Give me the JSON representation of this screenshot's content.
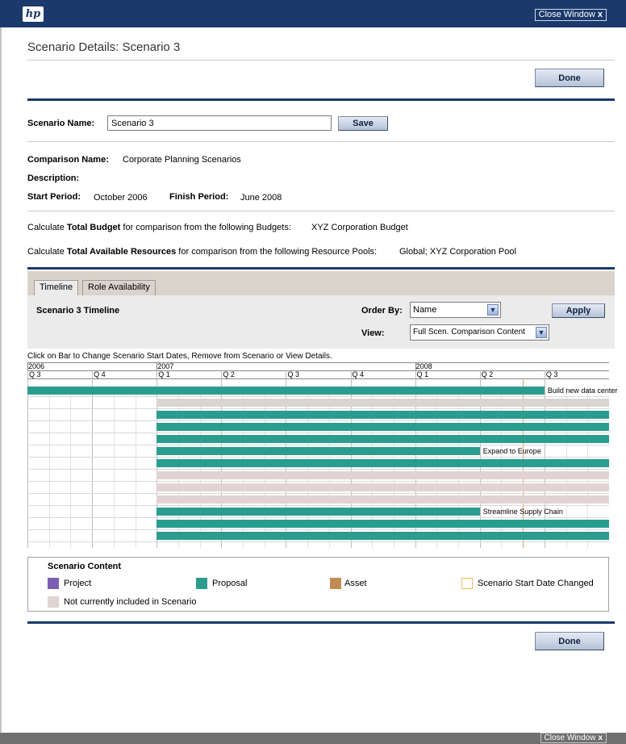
{
  "window": {
    "logo_text": "hp",
    "close_label": "Close Window",
    "close_x": "x"
  },
  "page": {
    "title": "Scenario Details: Scenario 3",
    "done_label": "Done"
  },
  "scenario": {
    "name_label": "Scenario Name:",
    "name_value": "Scenario 3",
    "save_label": "Save",
    "comparison_label": "Comparison Name:",
    "comparison_value": "Corporate Planning Scenarios",
    "description_label": "Description:",
    "start_label": "Start Period:",
    "start_value": "October 2006",
    "finish_label": "Finish Period:",
    "finish_value": "June 2008",
    "budget_pre": "Calculate",
    "budget_bold": "Total Budget",
    "budget_post": "for comparison from the following Budgets:",
    "budget_value": "XYZ Corporation Budget",
    "resources_pre": "Calculate",
    "resources_bold": "Total Available Resources",
    "resources_post": "for comparison from the following Resource Pools:",
    "resources_value": "Global; XYZ Corporation Pool"
  },
  "tabs": [
    {
      "label": "Timeline",
      "active": true
    },
    {
      "label": "Role Availability",
      "active": false
    }
  ],
  "timeline_panel": {
    "heading": "Scenario 3 Timeline",
    "order_by_label": "Order By:",
    "order_by_value": "Name",
    "view_label": "View:",
    "view_value": "Full Scen. Comparison Content",
    "apply_label": "Apply",
    "instructions": "Click on Bar to Change Scenario Start Dates, Remove from Scenario or View Details."
  },
  "timeline": {
    "years": [
      "2006",
      "2007",
      "2008"
    ],
    "quarters": [
      "Q 3",
      "Q 4",
      "Q 1",
      "Q 2",
      "Q 3",
      "Q 4",
      "Q 1",
      "Q 2",
      "Q 3"
    ],
    "rows": [
      {
        "start": "Q3 2006",
        "end": "Q2 2008",
        "type": "proposal",
        "label": "Build new data center"
      },
      {
        "start": "Q1 2007",
        "end": "Q3 2008",
        "type": "excluded",
        "label": ""
      },
      {
        "start": "Q1 2007",
        "end": "Q3 2008",
        "type": "proposal",
        "label": ""
      },
      {
        "start": "Q1 2007",
        "end": "Q3 2008",
        "type": "proposal",
        "label": ""
      },
      {
        "start": "Q1 2007",
        "end": "Q3 2008",
        "type": "proposal",
        "label": ""
      },
      {
        "start": "Q1 2007",
        "end": "Q1 2008",
        "type": "proposal",
        "label": "Expand to Europe"
      },
      {
        "start": "Q1 2007",
        "end": "Q3 2008",
        "type": "proposal",
        "label": ""
      },
      {
        "start": "Q1 2007",
        "end": "Q3 2008",
        "type": "excluded_pink",
        "label": ""
      },
      {
        "start": "Q1 2007",
        "end": "Q3 2008",
        "type": "excluded_pink",
        "label": ""
      },
      {
        "start": "Q1 2007",
        "end": "Q3 2008",
        "type": "excluded_pink",
        "label": ""
      },
      {
        "start": "Q1 2007",
        "end": "Q1 2008",
        "type": "proposal",
        "label": "Streamline Supply Chain"
      },
      {
        "start": "Q1 2007",
        "end": "Q3 2008",
        "type": "proposal",
        "label": ""
      },
      {
        "start": "Q1 2007",
        "end": "Q3 2008",
        "type": "proposal",
        "label": ""
      }
    ]
  },
  "legend": {
    "title": "Scenario Content",
    "items": [
      {
        "label": "Project",
        "color": "#7b5fb0"
      },
      {
        "label": "Proposal",
        "color": "#2a9d8f"
      },
      {
        "label": "Asset",
        "color": "#c08b55"
      },
      {
        "label": "Scenario Start Date Changed",
        "color": "#f5b968"
      },
      {
        "label": "Not currently included in Scenario",
        "color": "#dfd4cf"
      }
    ]
  },
  "colors": {
    "navy": "#1b3a6b",
    "proposal": "#2a9d8f",
    "excluded": "#d9d5cf",
    "excluded_pink": "#e1d3d3",
    "marker": "#e0a060"
  }
}
